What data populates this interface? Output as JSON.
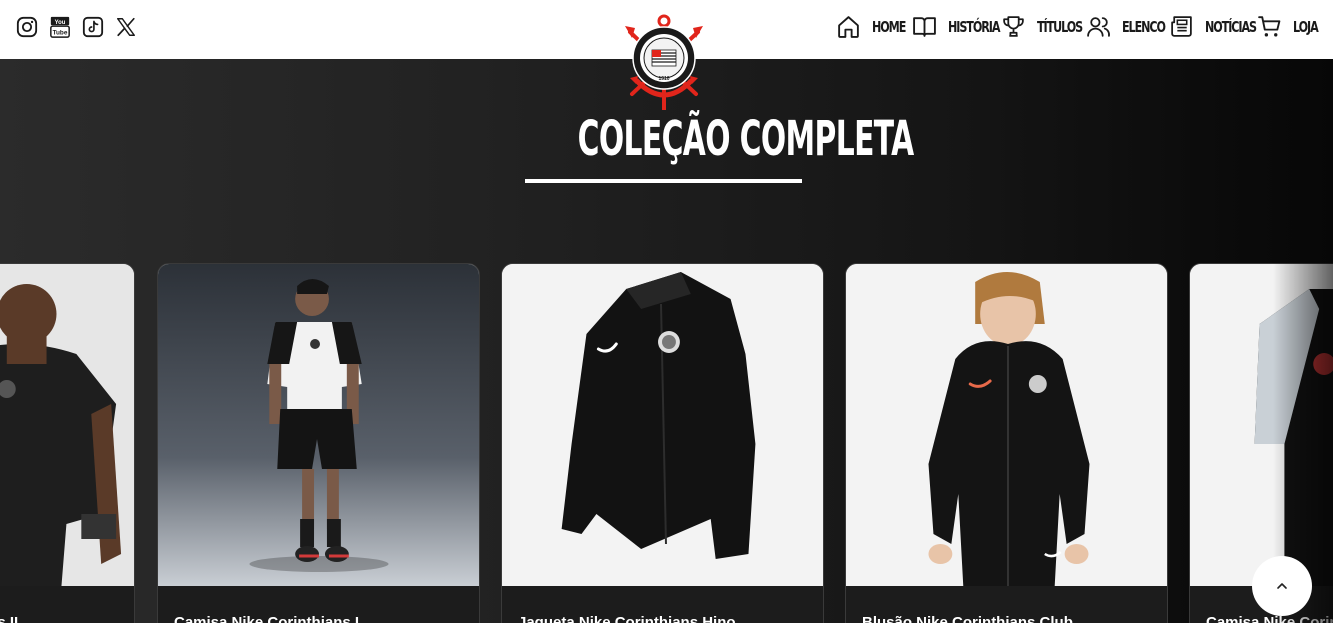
{
  "header": {
    "socials": [
      {
        "icon": "instagram-icon"
      },
      {
        "icon": "youtube-icon"
      },
      {
        "icon": "tiktok-icon"
      },
      {
        "icon": "x-twitter-icon"
      }
    ],
    "nav": [
      {
        "label": "HOME",
        "icon": "home-icon"
      },
      {
        "label": "HISTÓRIA",
        "icon": "book-icon"
      },
      {
        "label": "TÍTULOS",
        "icon": "trophy-icon"
      },
      {
        "label": "ELENCO",
        "icon": "users-icon"
      },
      {
        "label": "NOTÍCIAS",
        "icon": "newspaper-icon"
      },
      {
        "label": "LOJA",
        "icon": "cart-icon"
      }
    ],
    "logo_icon": "corinthians-crest-icon"
  },
  "section": {
    "title": "COLEÇÃO COMPLETA"
  },
  "products": [
    {
      "name": "Camisa Nike Corinthians II",
      "image": "black-jersey"
    },
    {
      "name": "Camisa Nike Corinthians I",
      "image": "white-jersey-model"
    },
    {
      "name": "Jaqueta Nike Corinthians Hino",
      "image": "black-jacket"
    },
    {
      "name": "Blusão Nike Corinthians Club",
      "image": "black-hoodie-kid"
    },
    {
      "name": "Camisa Nike Corinthians",
      "image": "black-grey-jersey"
    }
  ],
  "back_to_top": {
    "icon": "chevron-up-icon"
  },
  "colors": {
    "header_bg": "#ffffff",
    "page_bg": "#222222",
    "card_info_bg": "#1c1c1c",
    "crest_red": "#e1251b"
  }
}
